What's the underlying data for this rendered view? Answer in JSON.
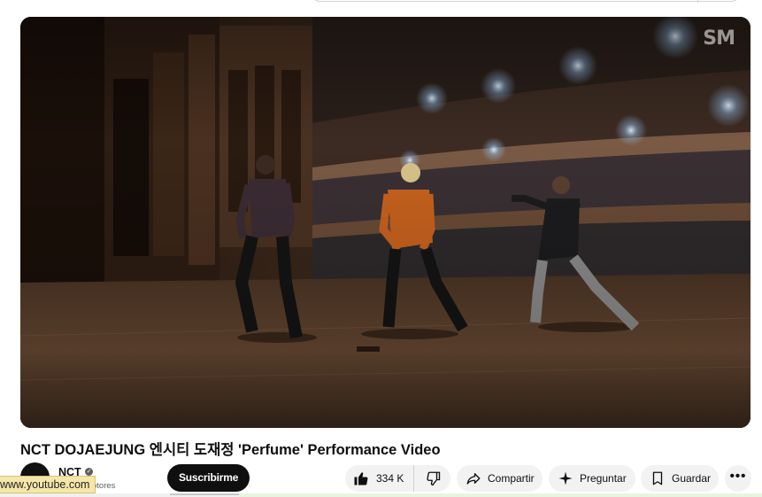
{
  "video": {
    "title": "NCT DOJAEJUNG 엔시티 도재정 'Perfume' Performance Video",
    "watermark": "SM"
  },
  "channel": {
    "name": "NCT",
    "subscribers_partial": "de suscriptores",
    "subscribe_label": "Suscribirme",
    "verified_icon": "verified-check-icon"
  },
  "actions": {
    "like_count": "334 K",
    "share_label": "Compartir",
    "ask_label": "Preguntar",
    "save_label": "Guardar",
    "more_label": "•••"
  },
  "status_url": "www.youtube.com"
}
